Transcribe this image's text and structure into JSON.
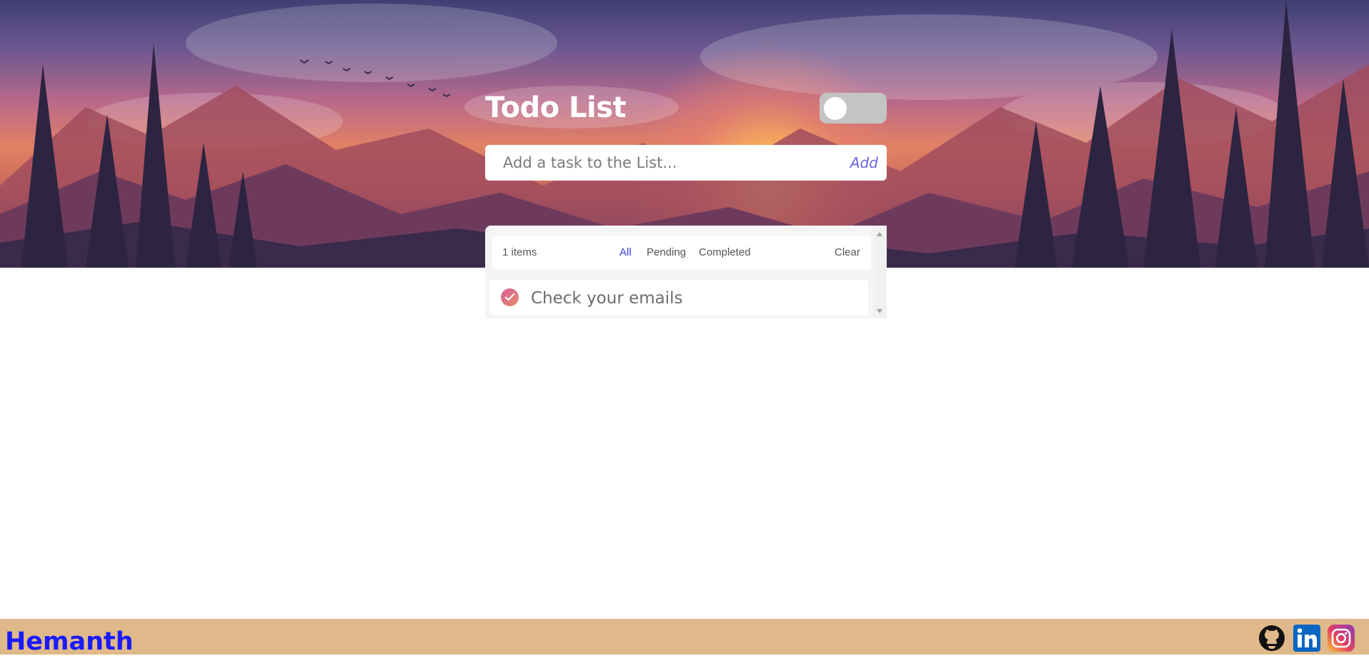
{
  "header": {
    "title": "Todo List",
    "theme_toggle": {
      "state": "off"
    }
  },
  "add_task": {
    "placeholder": "Add a task to the List...",
    "value": "",
    "add_label": "Add"
  },
  "list_controls": {
    "count_label": "1 items",
    "filters": [
      "All",
      "Pending",
      "Completed"
    ],
    "active_filter": "All",
    "clear_label": "Clear"
  },
  "tasks": [
    {
      "text": "Check your emails",
      "checkbox_icon": "check-icon"
    }
  ],
  "footer": {
    "brand": "Hemanth",
    "social_icons": [
      "github-icon",
      "linkedin-icon",
      "instagram-icon"
    ]
  },
  "colors": {
    "accent": "#6c63e0",
    "active_filter": "#3b3fe0",
    "footer_bg": "#dfb98a",
    "brand": "#1a1aff"
  }
}
